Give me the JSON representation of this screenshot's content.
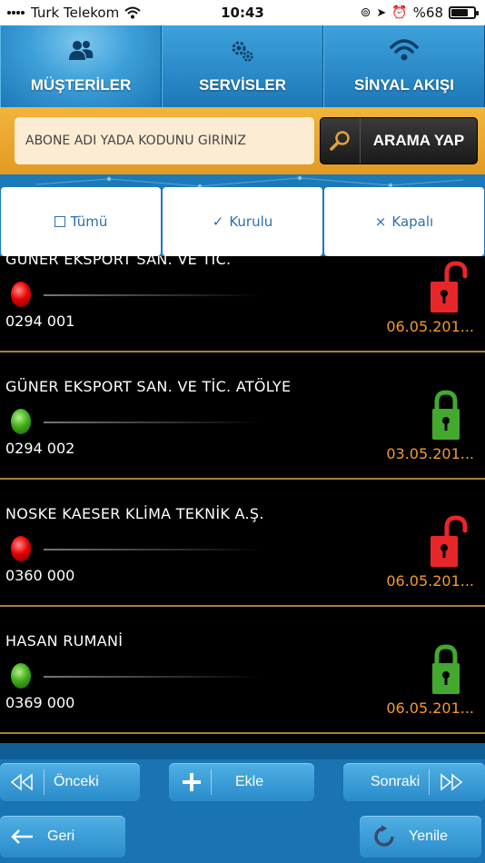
{
  "status_bar": {
    "carrier": "Turk Telekom",
    "time": "10:43",
    "battery_percent": "%68",
    "battery_level": 0.68
  },
  "tabs": [
    {
      "label": "MÜŞTERİLER",
      "icon": "users-icon",
      "active": true
    },
    {
      "label": "SERVİSLER",
      "icon": "gears-icon",
      "active": false
    },
    {
      "label": "SİNYAL AKIŞI",
      "icon": "wifi-icon",
      "active": false
    }
  ],
  "search": {
    "placeholder": "ABONE ADI YADA KODUNU GİRİNİZ",
    "value": "",
    "button_label": "ARAMA YAP"
  },
  "filters": [
    {
      "label": "Tümü",
      "icon": "checkbox-icon"
    },
    {
      "label": "Kurulu",
      "icon": "check-icon"
    },
    {
      "label": "Kapalı",
      "icon": "x-icon"
    }
  ],
  "customers": [
    {
      "name": "GÜNER EKSPORT SAN. VE TİC.",
      "code": "0294 001",
      "date": "06.05.201...",
      "status": "red",
      "lock": "unlocked"
    },
    {
      "name": "GÜNER EKSPORT SAN. VE TİC. ATÖLYE",
      "code": "0294 002",
      "date": "03.05.201...",
      "status": "green",
      "lock": "locked"
    },
    {
      "name": "NOSKE KAESER KLİMA TEKNİK A.Ş.",
      "code": "0360 000",
      "date": "06.05.201...",
      "status": "red",
      "lock": "unlocked"
    },
    {
      "name": "HASAN RUMANİ",
      "code": "0369 000",
      "date": "06.05.201...",
      "status": "green",
      "lock": "locked"
    }
  ],
  "colors": {
    "lock_red": "#e8262a",
    "lock_green": "#43a82e",
    "date_orange": "#f29a2e",
    "accent_blue": "#2a8bcb",
    "search_orange": "#eca52e"
  },
  "navigation": {
    "prev_label": "Önceki",
    "add_label": "Ekle",
    "next_label": "Sonraki",
    "back_label": "Geri",
    "refresh_label": "Yenile"
  }
}
